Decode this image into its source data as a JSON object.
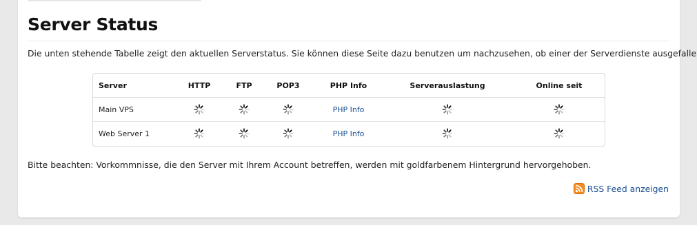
{
  "page": {
    "title": "Server Status",
    "intro": "Die unten stehende Tabelle zeigt den aktuellen Serverstatus. Sie können diese Seite dazu benutzen um nachzusehen, ob einer der Serverdienste ausgefallen ist.",
    "note": "Bitte beachten: Vorkommnisse, die den Server mit Ihrem Account betreffen, werden mit goldfarbenem Hintergrund hervorgehoben."
  },
  "table": {
    "headers": [
      "Server",
      "HTTP",
      "FTP",
      "POP3",
      "PHP Info",
      "Serverauslastung",
      "Online seit"
    ],
    "rows": [
      {
        "server": "Main VPS",
        "http": "loading-spinner-icon",
        "ftp": "loading-spinner-icon",
        "pop3": "loading-spinner-icon",
        "php_info": "PHP Info",
        "load": "loading-spinner-icon",
        "uptime": "loading-spinner-icon"
      },
      {
        "server": "Web Server 1",
        "http": "loading-spinner-icon",
        "ftp": "loading-spinner-icon",
        "pop3": "loading-spinner-icon",
        "php_info": "PHP Info",
        "load": "loading-spinner-icon",
        "uptime": "loading-spinner-icon"
      }
    ]
  },
  "rss": {
    "label": "RSS Feed anzeigen",
    "icon": "rss-icon"
  },
  "colors": {
    "link": "#1b4f94",
    "rss_orange": "#f68b1f",
    "background": "#e9e9e9"
  }
}
